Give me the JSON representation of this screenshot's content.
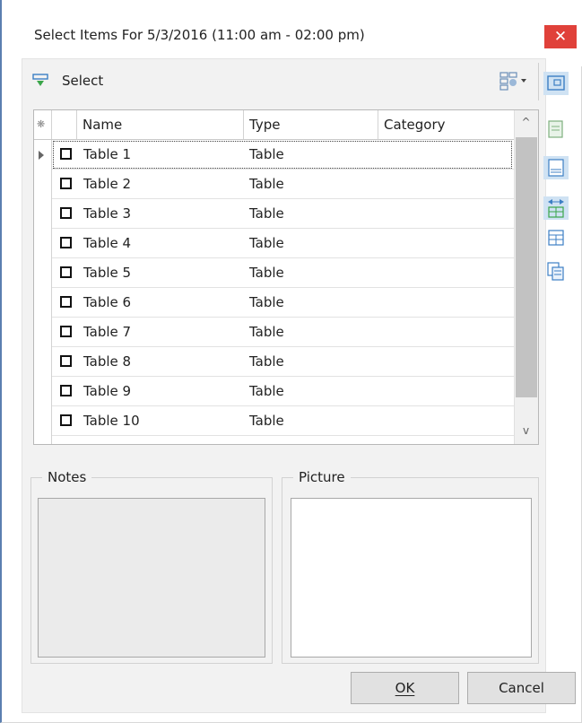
{
  "window": {
    "title": "Select Items For 5/3/2016 (11:00 am - 02:00 pm)",
    "close_glyph": "✕"
  },
  "toolbar": {
    "select_label": "Select",
    "select_icon": "select-filter-icon",
    "layout_icon": "column-chooser-icon"
  },
  "right_rail": {
    "items": [
      "card-view-icon",
      "detail-view-icon",
      "table-view-icon",
      "fit-columns-icon",
      "group-panel-icon",
      "band-view-icon"
    ]
  },
  "grid": {
    "header_icon": "❋",
    "columns": [
      "Name",
      "Type",
      "Category"
    ],
    "rows": [
      {
        "name": "Table 1",
        "type": "Table",
        "category": ""
      },
      {
        "name": "Table 2",
        "type": "Table",
        "category": ""
      },
      {
        "name": "Table 3",
        "type": "Table",
        "category": ""
      },
      {
        "name": "Table 4",
        "type": "Table",
        "category": ""
      },
      {
        "name": "Table 5",
        "type": "Table",
        "category": ""
      },
      {
        "name": "Table 6",
        "type": "Table",
        "category": ""
      },
      {
        "name": "Table 7",
        "type": "Table",
        "category": ""
      },
      {
        "name": "Table 8",
        "type": "Table",
        "category": ""
      },
      {
        "name": "Table 9",
        "type": "Table",
        "category": ""
      },
      {
        "name": "Table 10",
        "type": "Table",
        "category": ""
      }
    ],
    "scroll_up": "^",
    "scroll_down": "v"
  },
  "notes": {
    "label": "Notes"
  },
  "picture": {
    "label": "Picture"
  },
  "buttons": {
    "ok_label": "OK",
    "cancel_label": "Cancel"
  },
  "colors": {
    "close_bg": "#e0413a",
    "accent_blue": "#3c7fc4",
    "select_icon_green": "#3aa64a"
  }
}
